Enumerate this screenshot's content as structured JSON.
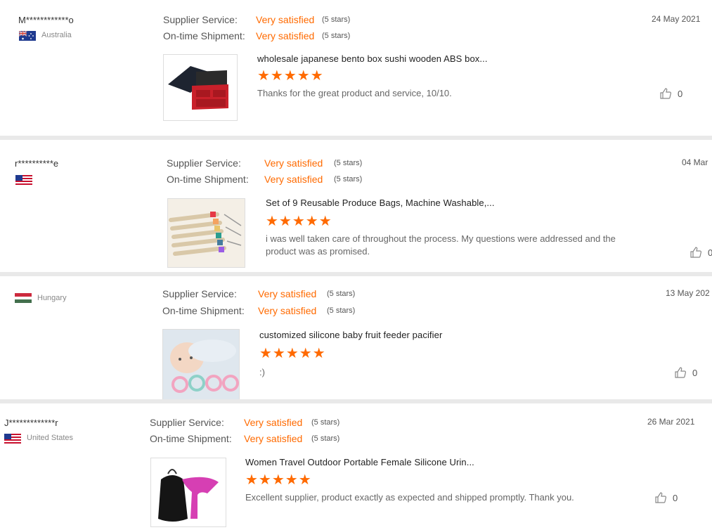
{
  "labels": {
    "supplier_service": "Supplier Service:",
    "ontime_shipment": "On-time Shipment:"
  },
  "reviews": [
    {
      "name": "M************o",
      "country": "Australia",
      "flag": "australia-flag-icon",
      "supplier_rating": "Very satisfied",
      "supplier_stars": "(5 stars)",
      "shipment_rating": "Very satisfied",
      "shipment_stars": "(5 stars)",
      "date": "24 May 2021",
      "product_title": "wholesale japanese bento box sushi wooden ABS box...",
      "stars": "★★★★★",
      "comment": "Thanks for the great product and service, 10/10.",
      "likes": "0"
    },
    {
      "name": "r**********e",
      "country": "",
      "flag": "usa-flag-icon",
      "supplier_rating": "Very satisfied",
      "supplier_stars": "(5 stars)",
      "shipment_rating": "Very satisfied",
      "shipment_stars": "(5 stars)",
      "date": "04 Mar",
      "product_title": "Set of 9 Reusable Produce Bags, Machine Washable,...",
      "stars": "★★★★★",
      "comment": "i was well taken care of throughout the process. My questions were addressed and the product was as promised.",
      "likes": "0"
    },
    {
      "name": "",
      "country": "Hungary",
      "flag": "hungary-flag-icon",
      "supplier_rating": "Very satisfied",
      "supplier_stars": "(5 stars)",
      "shipment_rating": "Very satisfied",
      "shipment_stars": "(5 stars)",
      "date": "13 May 202",
      "product_title": "customized silicone baby fruit feeder pacifier",
      "stars": "★★★★★",
      "comment": ":)",
      "likes": "0"
    },
    {
      "name": "J*************r",
      "country": "United States",
      "flag": "usa-flag-icon",
      "supplier_rating": "Very satisfied",
      "supplier_stars": "(5 stars)",
      "shipment_rating": "Very satisfied",
      "shipment_stars": "(5 stars)",
      "date": "26 Mar 2021",
      "product_title": "Women Travel Outdoor Portable Female Silicone Urin...",
      "stars": "★★★★★",
      "comment": "Excellent supplier, product exactly as expected and shipped promptly.  Thank you.",
      "likes": "0"
    }
  ],
  "colors": {
    "accent": "#ff6a00",
    "stars": "#ff6a00"
  }
}
